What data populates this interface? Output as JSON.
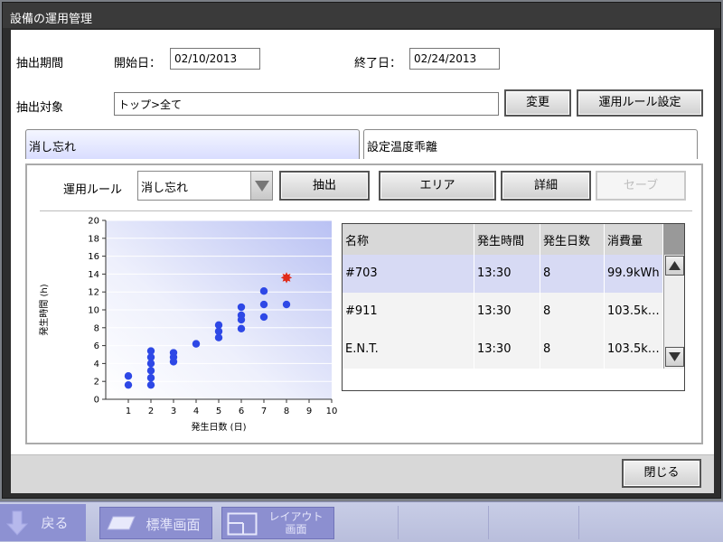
{
  "window": {
    "title": "設備の運用管理"
  },
  "period": {
    "label": "抽出期間",
    "start_label": "開始日：",
    "start_value": "02/10/2013",
    "end_label": "終了日：",
    "end_value": "02/24/2013"
  },
  "target": {
    "label": "抽出対象",
    "value": "トップ>全て",
    "change_button": "変更",
    "rule_setting_button": "運用ルール設定"
  },
  "tabs": [
    {
      "label": "消し忘れ",
      "active": true
    },
    {
      "label": "設定温度乖離",
      "active": false
    }
  ],
  "rule": {
    "label": "運用ルール",
    "selected": "消し忘れ"
  },
  "actions": {
    "extract": "抽出",
    "area": "エリア",
    "detail": "詳細",
    "save": "セーブ"
  },
  "table": {
    "headers": [
      "名称",
      "発生時間",
      "発生日数",
      "消費量"
    ],
    "rows": [
      {
        "name": "#703",
        "time": "13:30",
        "days": "8",
        "consumption": "99.9kWh",
        "selected": true
      },
      {
        "name": "#911",
        "time": "13:30",
        "days": "8",
        "consumption": "103.5k…",
        "selected": false
      },
      {
        "name": "E.N.T.",
        "time": "13:30",
        "days": "8",
        "consumption": "103.5k…",
        "selected": false
      }
    ]
  },
  "chart_data": {
    "type": "scatter",
    "xlabel": "発生日数 (日)",
    "ylabel": "発生時間 (h)",
    "xlim": [
      0,
      10
    ],
    "ylim": [
      0,
      20
    ],
    "xticks": [
      "1",
      "2",
      "3",
      "4",
      "5",
      "6",
      "7",
      "8",
      "9",
      "10"
    ],
    "yticks": [
      "0",
      "2",
      "4",
      "6",
      "8",
      "10",
      "12",
      "14",
      "16",
      "18",
      "20"
    ],
    "grid": true,
    "colors": {
      "points": "#2e48e6",
      "highlight": "#e02a1a"
    },
    "series": [
      {
        "points": [
          [
            1,
            1.6
          ],
          [
            1,
            2.6
          ],
          [
            2,
            1.6
          ],
          [
            2,
            2.4
          ],
          [
            2,
            3.2
          ],
          [
            2,
            4
          ],
          [
            2,
            4.7
          ],
          [
            2,
            5.4
          ],
          [
            3,
            4.2
          ],
          [
            3,
            4.7
          ],
          [
            3,
            5.2
          ],
          [
            4,
            6.2
          ],
          [
            5,
            6.9
          ],
          [
            5,
            7.6
          ],
          [
            5,
            8.3
          ],
          [
            6,
            7.9
          ],
          [
            6,
            8.9
          ],
          [
            6,
            9.4
          ],
          [
            6,
            10.3
          ],
          [
            7,
            9.2
          ],
          [
            7,
            10.6
          ],
          [
            7,
            12.1
          ],
          [
            8,
            10.6
          ]
        ]
      },
      {
        "points": [
          [
            8,
            13.6
          ]
        ],
        "highlight": true
      }
    ]
  },
  "footer": {
    "close_button": "閉じる"
  },
  "taskbar": {
    "back": "戻る",
    "standard_screen": "標準画面",
    "layout_screen_1": "レイアウト",
    "layout_screen_2": "画面"
  }
}
